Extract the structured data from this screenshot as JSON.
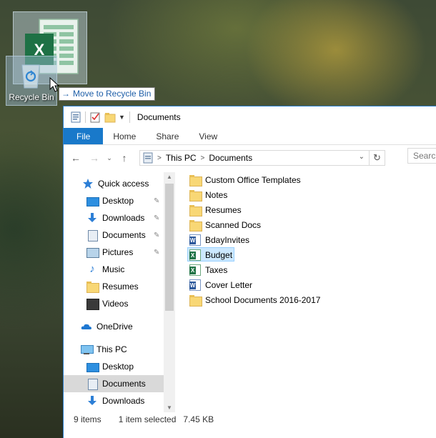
{
  "desktop": {
    "recycle_bin_label": "Recycle Bin",
    "drag_tooltip": "Move to Recycle Bin",
    "drag_file_type": "excel-icon"
  },
  "window": {
    "title": "Documents",
    "ribbon_tabs": [
      "File",
      "Home",
      "Share",
      "View"
    ],
    "address": {
      "segments": [
        "This PC",
        "Documents"
      ]
    },
    "search_placeholder": "Search Documents"
  },
  "nav_pane": {
    "items": [
      {
        "label": "Quick access",
        "icon": "star-icon",
        "pinned": false
      },
      {
        "label": "Desktop",
        "icon": "desktop-icon",
        "pinned": true
      },
      {
        "label": "Downloads",
        "icon": "downloads-icon",
        "pinned": true
      },
      {
        "label": "Documents",
        "icon": "documents-icon",
        "pinned": true
      },
      {
        "label": "Pictures",
        "icon": "pictures-icon",
        "pinned": true
      },
      {
        "label": "Music",
        "icon": "music-icon",
        "pinned": false
      },
      {
        "label": "Resumes",
        "icon": "folder-icon",
        "pinned": false
      },
      {
        "label": "Videos",
        "icon": "videos-icon",
        "pinned": false
      },
      {
        "label": "OneDrive",
        "icon": "onedrive-icon",
        "pinned": false
      },
      {
        "label": "This PC",
        "icon": "this-pc-icon",
        "pinned": false
      },
      {
        "label": "Desktop",
        "icon": "desktop-icon",
        "pinned": false
      },
      {
        "label": "Documents",
        "icon": "documents-icon",
        "pinned": false,
        "selected": true
      },
      {
        "label": "Downloads",
        "icon": "downloads-icon",
        "pinned": false
      }
    ]
  },
  "files": [
    {
      "name": "Custom Office Templates",
      "type": "folder"
    },
    {
      "name": "Notes",
      "type": "folder"
    },
    {
      "name": "Resumes",
      "type": "folder"
    },
    {
      "name": "Scanned Docs",
      "type": "folder"
    },
    {
      "name": "BdayInvites",
      "type": "word"
    },
    {
      "name": "Budget",
      "type": "excel",
      "selected": true
    },
    {
      "name": "Taxes",
      "type": "excel"
    },
    {
      "name": "Cover Letter",
      "type": "word"
    },
    {
      "name": "School Documents 2016-2017",
      "type": "folder"
    }
  ],
  "status": {
    "item_count": "9 items",
    "selection": "1 item selected",
    "size": "7.45 KB"
  },
  "colors": {
    "file_tab": "#1979ca",
    "selection_bg": "#cce8ff",
    "selection_border": "#99d1ff"
  }
}
